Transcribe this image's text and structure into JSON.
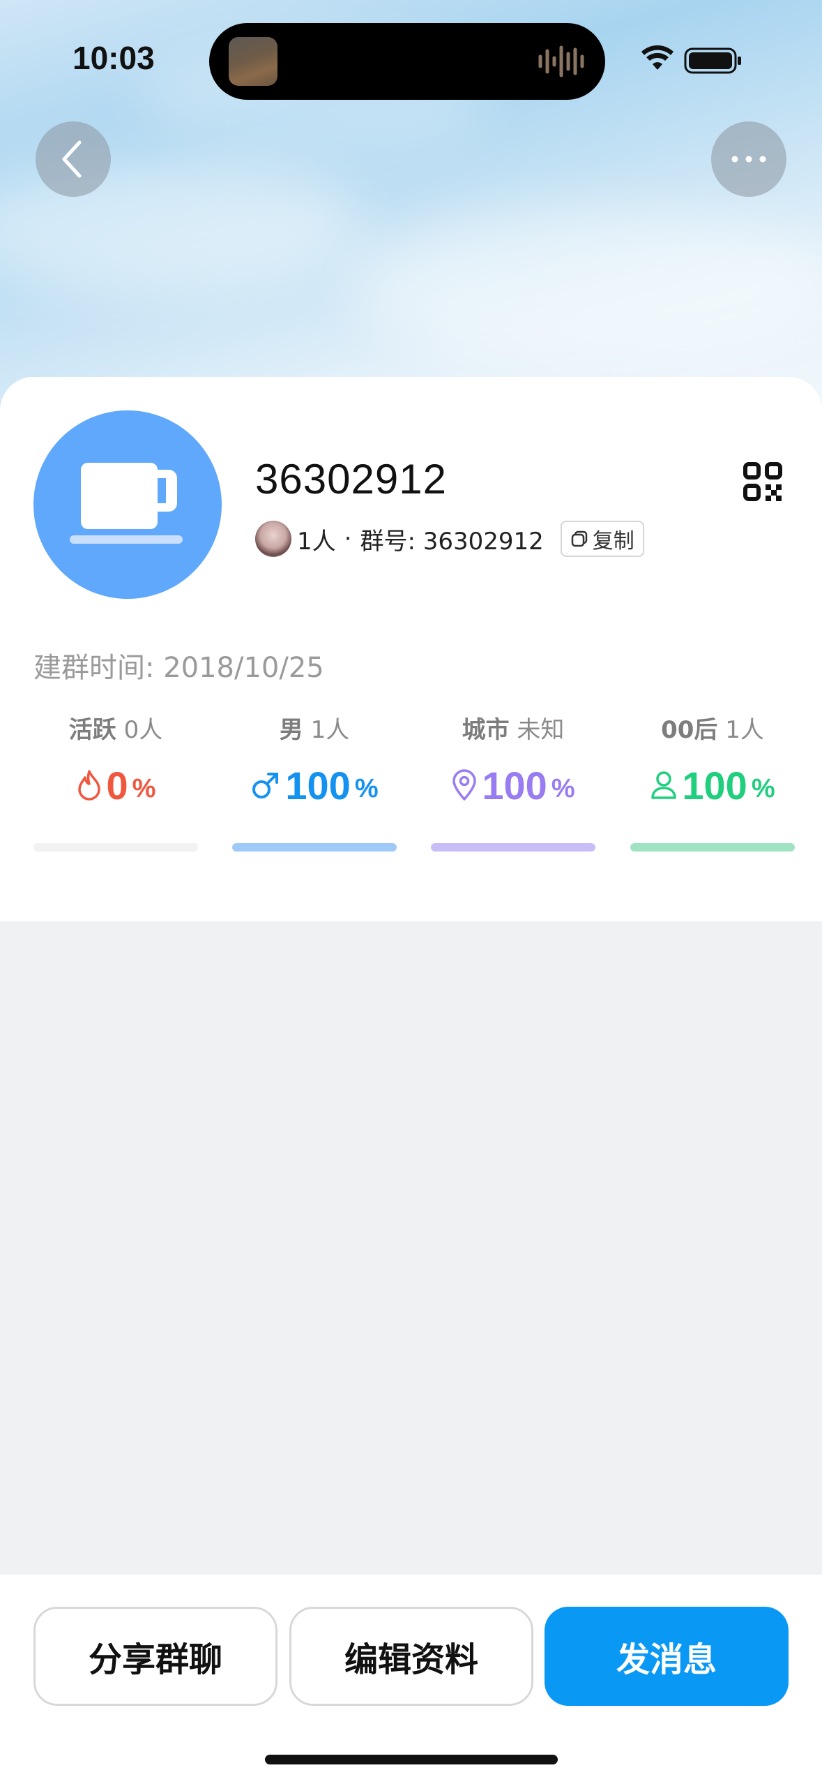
{
  "status_bar": {
    "time": "10:03"
  },
  "group": {
    "name": "36302912",
    "member_count": "1人",
    "separator": "·",
    "group_id_label": "群号: 36302912",
    "copy_label": "复制",
    "created_label": "建群时间: 2018/10/25"
  },
  "stats": [
    {
      "label": "活跃",
      "count": "0人",
      "icon": "flame-icon",
      "value": "0",
      "unit": "%",
      "color": "#f0573f",
      "bar_color": "#f2f2f2"
    },
    {
      "label": "男",
      "count": "1人",
      "icon": "male-icon",
      "value": "100",
      "unit": "%",
      "color": "#1592f0",
      "bar_color": "#9fcaf7"
    },
    {
      "label": "城市",
      "count": "未知",
      "icon": "location-pin-icon",
      "value": "100",
      "unit": "%",
      "color": "#9a7cf2",
      "bar_color": "#c8bdf6"
    },
    {
      "label": "00后",
      "count": "1人",
      "icon": "person-icon",
      "value": "100",
      "unit": "%",
      "color": "#1fcf7e",
      "bar_color": "#9fe3c2"
    }
  ],
  "buttons": {
    "share": "分享群聊",
    "edit": "编辑资料",
    "message": "发消息"
  },
  "colors": {
    "accent": "#0a98f5",
    "avatar_bg": "#5fa8fb"
  }
}
